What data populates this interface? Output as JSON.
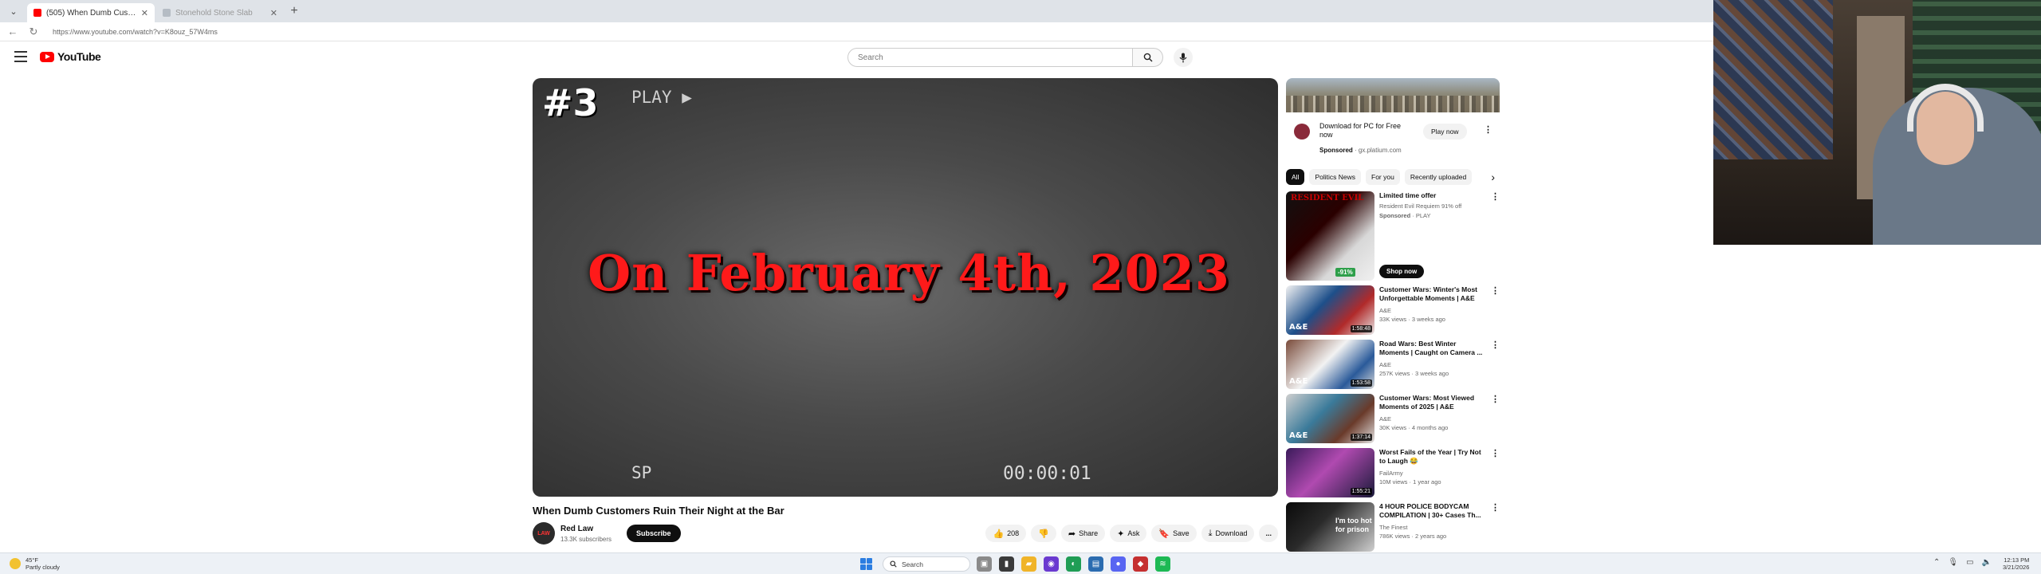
{
  "browser": {
    "tabs": [
      {
        "title": "(505) When Dumb Customers",
        "active": true
      },
      {
        "title": "Stonehold Stone Slab",
        "active": false
      }
    ],
    "new_tab": "+",
    "url": "https://www.youtube.com/watch?v=K8ouz_57W4ms"
  },
  "header": {
    "logo_text": "YouTube",
    "search_placeholder": "Search"
  },
  "player": {
    "rank": "#3",
    "play_tag": "PLAY ▶",
    "headline": "On February 4th, 2023",
    "sp_tag": "SP",
    "timecode": "00:00:01"
  },
  "video": {
    "title": "When Dumb Customers Ruin Their Night at the Bar",
    "channel": {
      "avatar_text": "LAW",
      "name": "Red Law",
      "subscribers": "13.3K subscribers",
      "subscribe_label": "Subscribe"
    },
    "actions": {
      "likes": "208",
      "share": "Share",
      "ask": "Ask",
      "save": "Save",
      "download": "Download",
      "more": "..."
    }
  },
  "ad": {
    "title": "Download for PC for Free now",
    "sponsored": "Sponsored",
    "domain": "gx.platium.com",
    "button": "Play now"
  },
  "chips": [
    "All",
    "Politics News",
    "For you",
    "Recently uploaded"
  ],
  "recommendations": [
    {
      "title": "Limited time offer",
      "line2": "Resident Evil Requiem 91% off",
      "sponsored": "Sponsored",
      "advertiser": "PLAY",
      "thumb_text": "RESIDENT EVIL",
      "discount": "-91%",
      "button": "Shop now"
    },
    {
      "title": "Customer Wars: Winter's Most Unforgettable Moments | A&E",
      "channel": "A&E",
      "meta": "33K views · 3 weeks ago",
      "duration": "1:58:48"
    },
    {
      "title": "Road Wars: Best Winter Moments | Caught on Camera ...",
      "channel": "A&E",
      "meta": "257K views · 3 weeks ago",
      "duration": "1:53:58"
    },
    {
      "title": "Customer Wars: Most Viewed Moments of 2025 | A&E",
      "channel": "A&E",
      "meta": "30K views · 4 months ago",
      "duration": "1:37:14"
    },
    {
      "title": "Worst Fails of the Year | Try Not to Laugh 😂",
      "channel": "FailArmy",
      "meta": "10M views · 1 year ago",
      "duration": "1:55:21"
    },
    {
      "title": "4 HOUR POLICE BODYCAM COMPILATION | 30+ Cases Th...",
      "channel": "The Finest",
      "meta": "786K views · 2 years ago",
      "overlay": "I'm too hot for prison"
    }
  ],
  "taskbar": {
    "weather_temp": "45°F",
    "weather_desc": "Partly cloudy",
    "search": "Search",
    "time": "12:13 PM",
    "date": "3/21/2026"
  }
}
